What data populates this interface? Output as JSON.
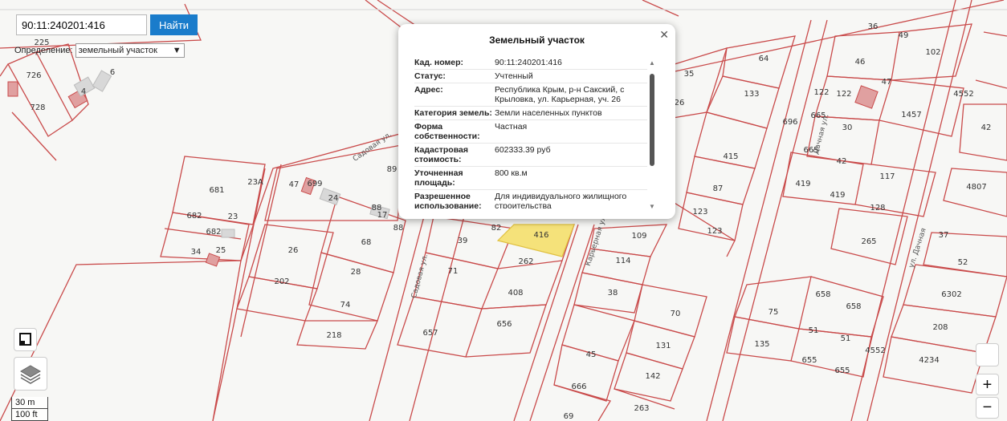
{
  "search": {
    "value": "90:11:240201:416",
    "button": "Найти"
  },
  "definition": {
    "label": "Определение:",
    "selected": "земельный участок"
  },
  "popup": {
    "title": "Земельный участок",
    "rows": [
      {
        "key": "Кад. номер:",
        "value": "90:11:240201:416"
      },
      {
        "key": "Статус:",
        "value": "Учтенный"
      },
      {
        "key": "Адрес:",
        "value": "Республика Крым, р-н Сакский, с Крыловка, ул. Карьерная, уч. 26"
      },
      {
        "key": "Категория земель:",
        "value": "Земли населенных пунктов"
      },
      {
        "key": "Форма собственности:",
        "value": "Частная"
      },
      {
        "key": "Кадастровая стоимость:",
        "value": "602333.39 руб"
      },
      {
        "key": "Уточненная площадь:",
        "value": "800 кв.м"
      },
      {
        "key": "Разрешенное использование:",
        "value": "Для индивидуального жилищного строительства"
      }
    ]
  },
  "map": {
    "colors": {
      "parcel": "#c94a4a",
      "highlight": "#f5e27a",
      "building": "#e0a0a0"
    },
    "parcel_labels": [
      "225",
      "726",
      "728",
      "4",
      "6",
      "681",
      "23А",
      "682",
      "23",
      "682",
      "34",
      "25",
      "47",
      "699",
      "24",
      "89",
      "88",
      "17",
      "88",
      "26",
      "68",
      "202",
      "28",
      "74",
      "218",
      "39",
      "82",
      "416",
      "262",
      "71",
      "408",
      "657",
      "656",
      "35",
      "26",
      "64",
      "133",
      "415",
      "87",
      "123",
      "123",
      "109",
      "114",
      "38",
      "70",
      "131",
      "45",
      "142",
      "666",
      "263",
      "69",
      "36",
      "49",
      "102",
      "46",
      "47",
      "122",
      "122",
      "665",
      "30",
      "1457",
      "42",
      "665",
      "42",
      "117",
      "419",
      "419",
      "128",
      "4807",
      "265",
      "37",
      "52",
      "6302",
      "208",
      "4234",
      "658",
      "658",
      "75",
      "51",
      "51",
      "135",
      "655",
      "655",
      "4552",
      "4552",
      "696"
    ],
    "street_labels": [
      "Садовая ул.",
      "Садовая ул.",
      "Карьерная ул.",
      "Дачная ул.",
      "ул. Дачная"
    ]
  },
  "scale": {
    "metric": "30 m",
    "imperial": "100 ft"
  },
  "zoom": {
    "in": "+",
    "out": "−"
  },
  "icons": [
    "close-icon",
    "fullscreen-icon",
    "layers-icon",
    "square-icon",
    "chevron-down-icon",
    "scroll-up-icon",
    "scroll-down-icon"
  ]
}
